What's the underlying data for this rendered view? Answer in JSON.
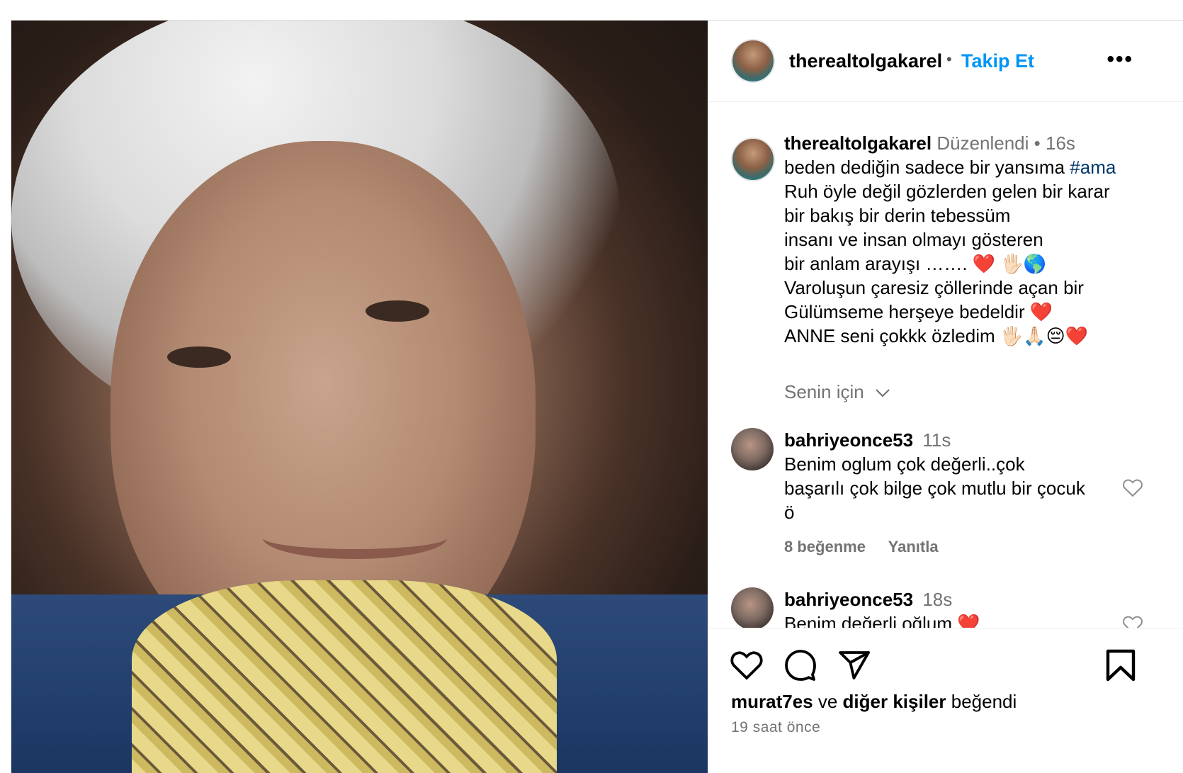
{
  "post": {
    "username": "therealtolgakarel",
    "follow_label": "Takip Et",
    "more_label": "•••",
    "separator": "•"
  },
  "caption": {
    "username": "therealtolgakarel",
    "edited": "Düzenlendi",
    "dot": "•",
    "time": "16s",
    "line1_text": "beden dediğin sadece bir yansıma ",
    "line1_tag": "#ama",
    "lines": [
      "Ruh öyle değil gözlerden gelen bir karar",
      "bir bakış bir derin tebessüm",
      "insanı ve insan olmayı gösteren",
      "bir anlam arayışı ……. ❤️ 🖐🏻🌎",
      "Varoluşun çaresiz çöllerinde açan bir",
      "Gülümseme herşeye bedeldir ❤️",
      "ANNE seni çokkk özledim 🖐🏻🙏🏻😔❤️"
    ]
  },
  "senin_icin": "Senin için",
  "comments": [
    {
      "username": "bahriyeonce53",
      "time": "11s",
      "lines": [
        "Benim oglum çok değerli..çok",
        "başarılı çok bilge çok mutlu bir çocuk",
        "ö"
      ],
      "likes": "8 beğenme",
      "reply": "Yanıtla"
    },
    {
      "username": "bahriyeonce53",
      "time": "18s",
      "lines": [
        "Benim değerli oğlum ❤️"
      ]
    }
  ],
  "footer": {
    "liked_user": "murat7es",
    "liked_mid": " ve ",
    "liked_others": "diğer kişiler",
    "liked_end": " beğendi",
    "time_ago": "19 saat önce"
  },
  "colors": {
    "accent": "#0095f6",
    "muted": "#737373",
    "hashtag": "#00376b"
  },
  "icons": [
    "heart-icon",
    "comment-icon",
    "share-icon",
    "bookmark-icon",
    "more-icon",
    "chevron-down-icon"
  ]
}
